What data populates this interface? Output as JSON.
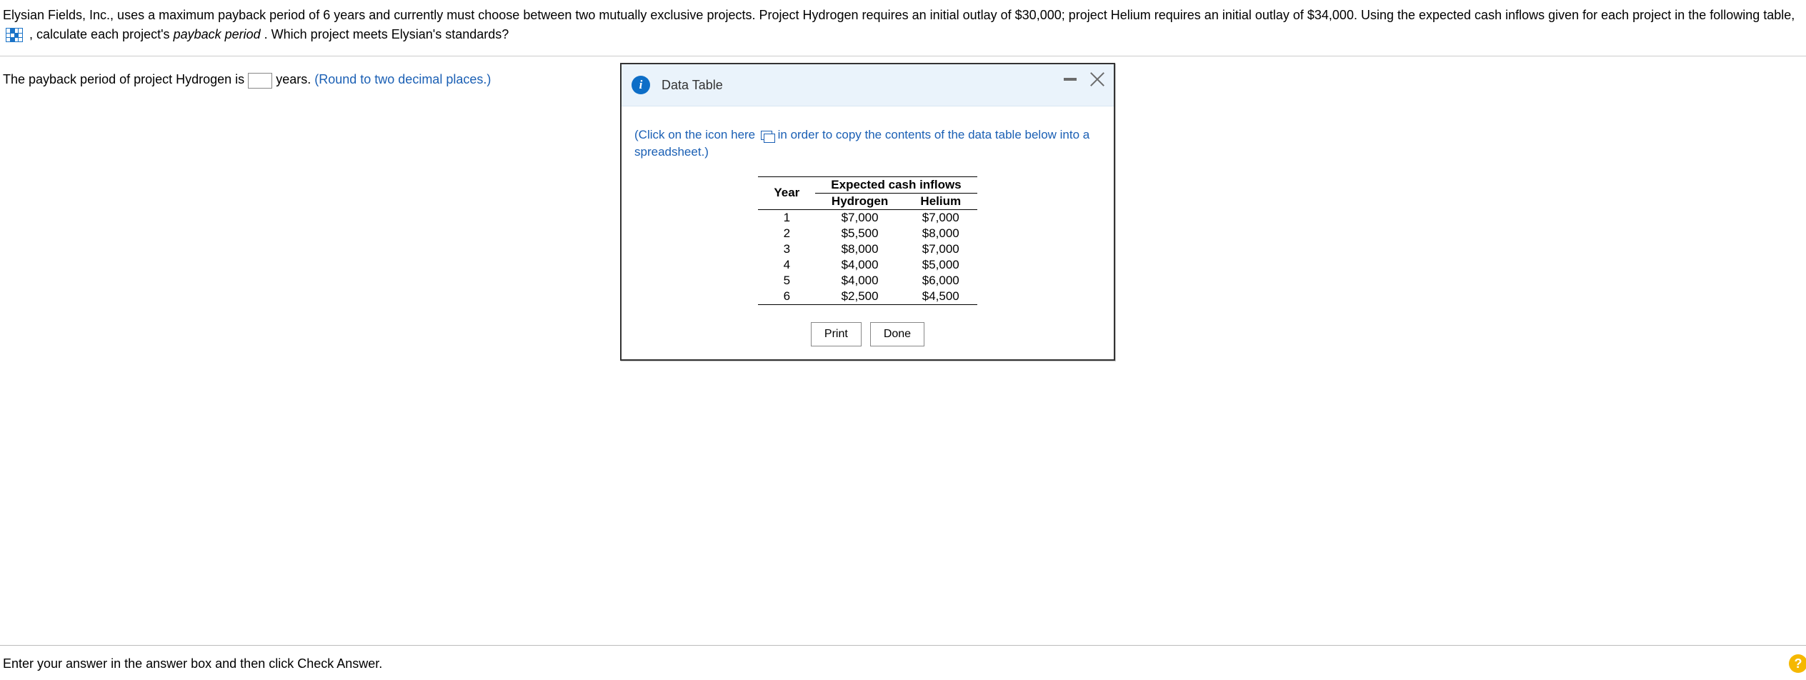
{
  "problem": {
    "part1": "Elysian Fields, Inc., uses a maximum payback period of 6 years and currently must choose between two mutually exclusive projects.  Project Hydrogen requires an initial outlay of $30,000; project Helium requires an initial outlay of $34,000.  Using the expected cash inflows given for each project in the following table, ",
    "part2": " , calculate each project's ",
    "payback_italic": "payback period",
    "part3": ".  Which project meets Elysian's standards?"
  },
  "answer_prompt": {
    "before": "The payback period of project Hydrogen is ",
    "after": " years.  ",
    "hint": "(Round to two decimal places.)"
  },
  "modal": {
    "title": "Data Table",
    "copy_note_before": "(Click on the icon here ",
    "copy_note_after": "  in order to copy the contents of the data table below into a spreadsheet.)",
    "table": {
      "group_header": "Expected cash inflows",
      "year_header": "Year",
      "col1": "Hydrogen",
      "col2": "Helium",
      "rows": [
        {
          "year": "1",
          "hydrogen": "$7,000",
          "helium": "$7,000"
        },
        {
          "year": "2",
          "hydrogen": "$5,500",
          "helium": "$8,000"
        },
        {
          "year": "3",
          "hydrogen": "$8,000",
          "helium": "$7,000"
        },
        {
          "year": "4",
          "hydrogen": "$4,000",
          "helium": "$5,000"
        },
        {
          "year": "5",
          "hydrogen": "$4,000",
          "helium": "$6,000"
        },
        {
          "year": "6",
          "hydrogen": "$2,500",
          "helium": "$4,500"
        }
      ]
    },
    "print_btn": "Print",
    "done_btn": "Done"
  },
  "footer": {
    "instruction": "Enter your answer in the answer box and then click Check Answer.",
    "help": "?"
  }
}
